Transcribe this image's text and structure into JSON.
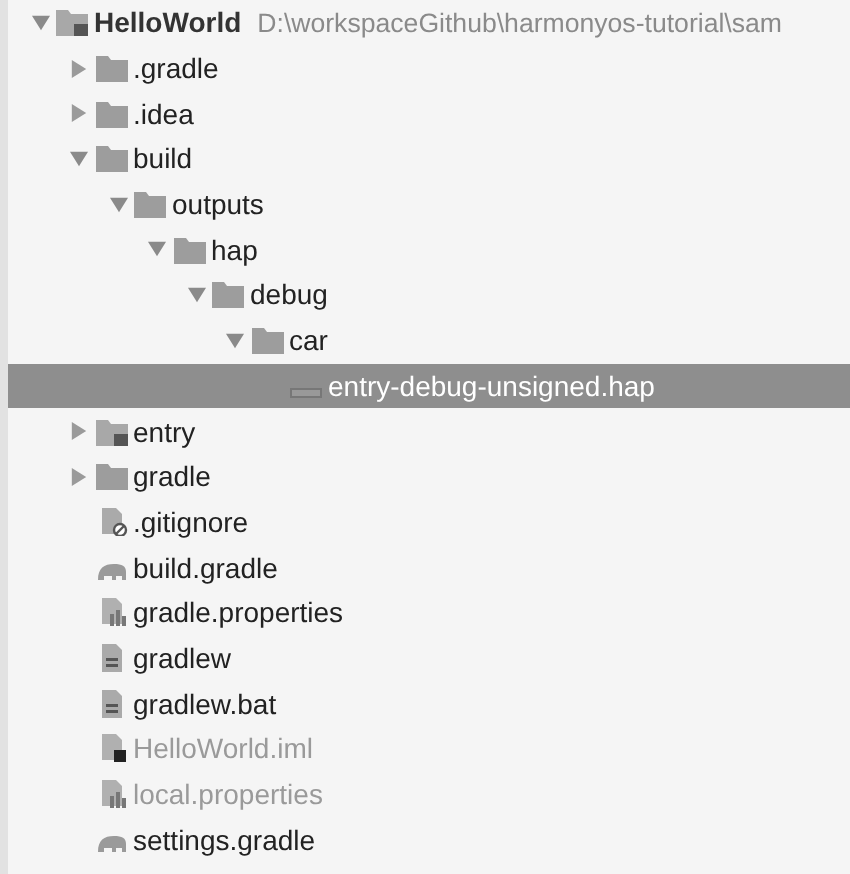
{
  "tree": [
    {
      "label": "HelloWorld",
      "path": "D:\\workspaceGithub\\harmonyos-tutorial\\sam",
      "kind": "module",
      "expanded": true,
      "selected": false,
      "ignored": false,
      "children": [
        {
          "label": ".gradle",
          "kind": "folder",
          "expanded": false,
          "selected": false,
          "ignored": false
        },
        {
          "label": ".idea",
          "kind": "folder",
          "expanded": false,
          "selected": false,
          "ignored": false
        },
        {
          "label": "build",
          "kind": "folder",
          "expanded": true,
          "selected": false,
          "ignored": false,
          "children": [
            {
              "label": "outputs",
              "kind": "folder",
              "expanded": true,
              "selected": false,
              "ignored": false,
              "children": [
                {
                  "label": "hap",
                  "kind": "folder",
                  "expanded": true,
                  "selected": false,
                  "ignored": false,
                  "children": [
                    {
                      "label": "debug",
                      "kind": "folder",
                      "expanded": true,
                      "selected": false,
                      "ignored": false,
                      "children": [
                        {
                          "label": "car",
                          "kind": "folder",
                          "expanded": true,
                          "selected": false,
                          "ignored": false,
                          "children": [
                            {
                              "label": "entry-debug-unsigned.hap",
                              "kind": "hap",
                              "selected": true,
                              "ignored": false
                            }
                          ]
                        }
                      ]
                    }
                  ]
                }
              ]
            }
          ]
        },
        {
          "label": "entry",
          "kind": "module",
          "expanded": false,
          "selected": false,
          "ignored": false
        },
        {
          "label": "gradle",
          "kind": "folder",
          "expanded": false,
          "selected": false,
          "ignored": false
        },
        {
          "label": ".gitignore",
          "kind": "gitignore",
          "selected": false,
          "ignored": false
        },
        {
          "label": "build.gradle",
          "kind": "gradle",
          "selected": false,
          "ignored": false
        },
        {
          "label": "gradle.properties",
          "kind": "properties",
          "selected": false,
          "ignored": false
        },
        {
          "label": "gradlew",
          "kind": "script",
          "selected": false,
          "ignored": false
        },
        {
          "label": "gradlew.bat",
          "kind": "script",
          "selected": false,
          "ignored": false
        },
        {
          "label": "HelloWorld.iml",
          "kind": "iml",
          "selected": false,
          "ignored": true
        },
        {
          "label": "local.properties",
          "kind": "properties",
          "selected": false,
          "ignored": true
        },
        {
          "label": "settings.gradle",
          "kind": "gradle",
          "selected": false,
          "ignored": false
        }
      ]
    }
  ]
}
